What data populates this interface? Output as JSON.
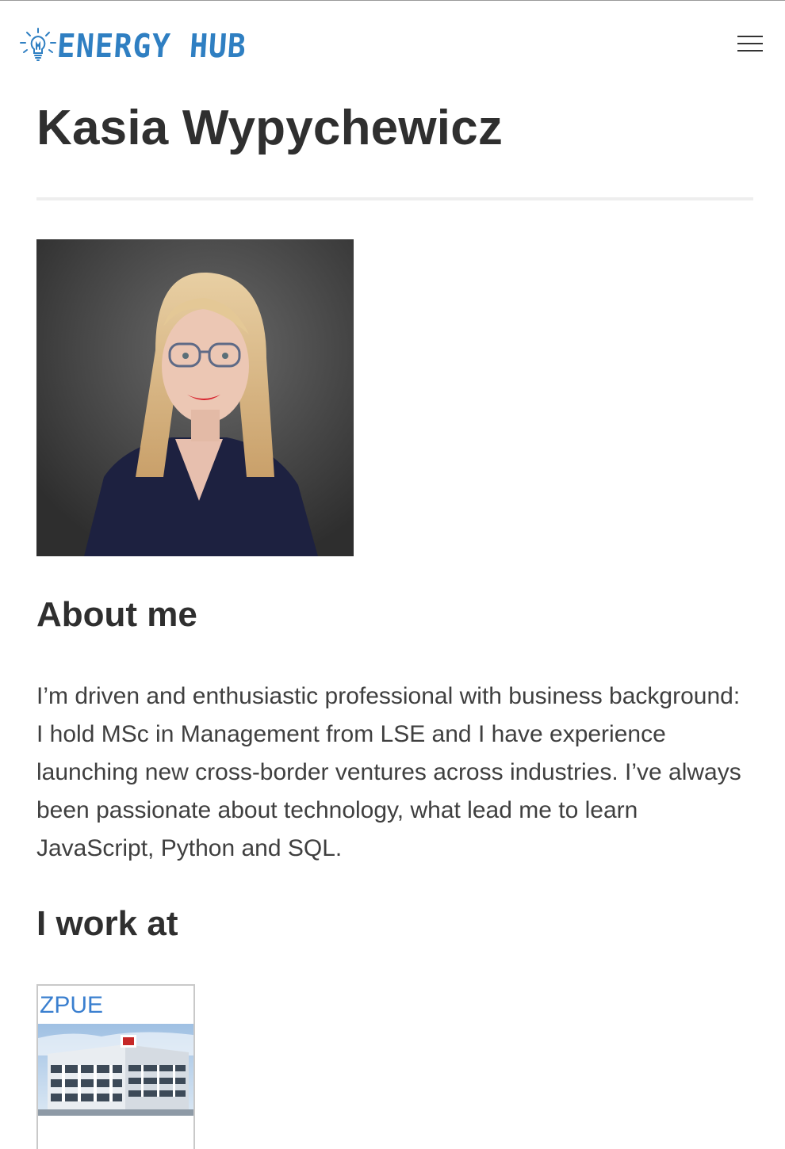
{
  "header": {
    "logo_text": "ENERGY HUB",
    "logo_icon": "lightbulb-icon",
    "menu_icon": "hamburger-menu-icon"
  },
  "profile": {
    "name": "Kasia Wypychewicz",
    "photo_alt": "Kasia Wypychewicz"
  },
  "about": {
    "heading": "About me",
    "text": "I’m driven and enthusiastic professional with business background: I hold MSc in Management from LSE and I have experience launching new cross-border ventures across industries. I’ve always been passionate about technology, what lead me to learn JavaScript, Python and SQL."
  },
  "work": {
    "heading": "I work at",
    "companies": [
      {
        "name": "ZPUE",
        "image_alt": "ZPUE"
      }
    ]
  },
  "colors": {
    "brand_blue": "#2f7fc2",
    "link_blue": "#3a7fcf",
    "text": "#333333",
    "divider": "#eeeeee"
  }
}
